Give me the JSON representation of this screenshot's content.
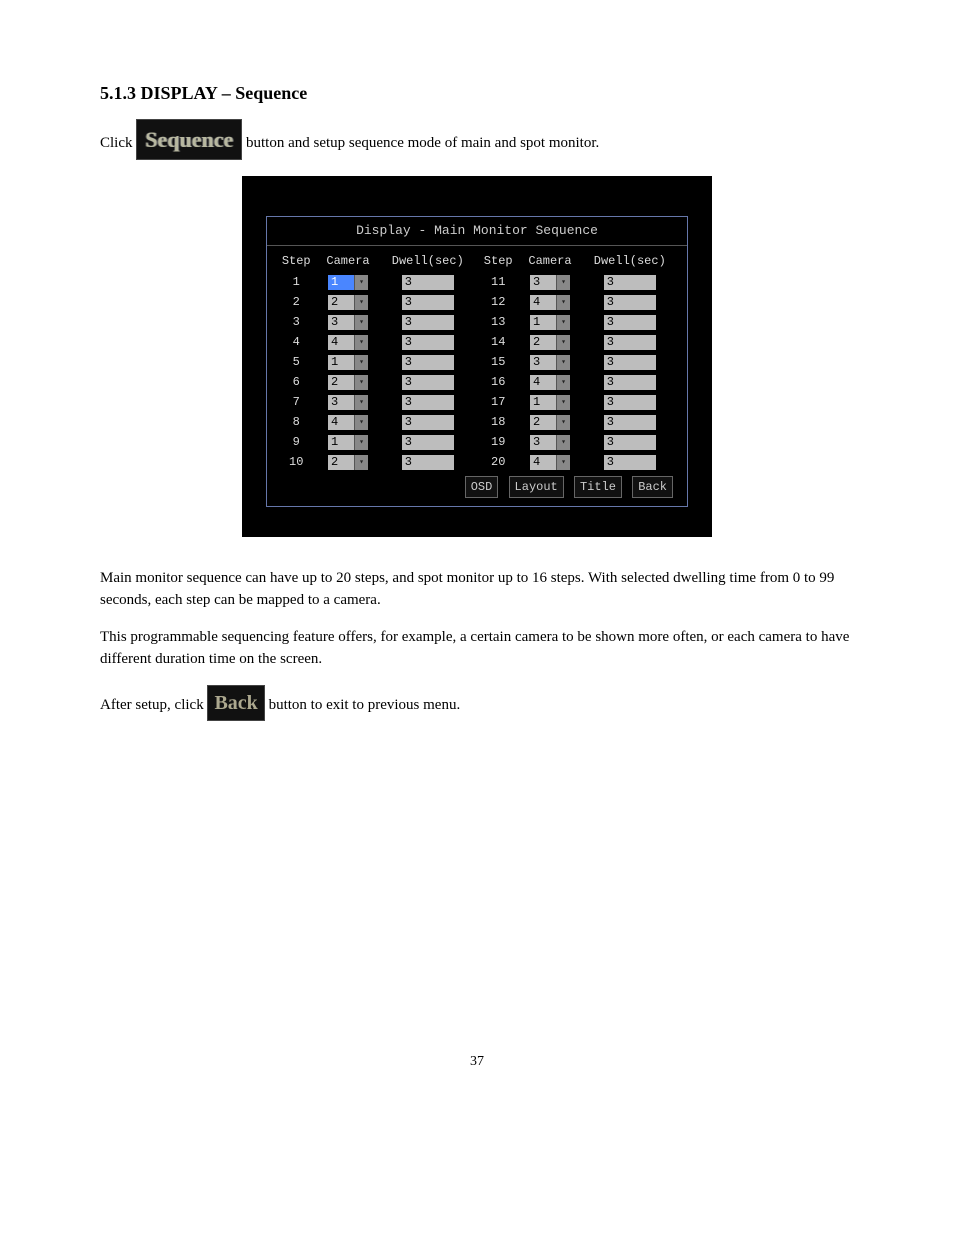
{
  "section1": {
    "title": "5.1.3 DISPLAY – Sequence",
    "click_prefix": "Click ",
    "button_label": "Sequence",
    "click_suffix": " button and setup sequence mode of main and spot monitor."
  },
  "screenshot": {
    "panel_title": "Display - Main Monitor Sequence",
    "headers": {
      "step": "Step",
      "camera": "Camera",
      "dwell": "Dwell(sec)"
    },
    "rows_left": [
      {
        "step": "1",
        "camera": "1",
        "dwell": "3",
        "selected": true
      },
      {
        "step": "2",
        "camera": "2",
        "dwell": "3"
      },
      {
        "step": "3",
        "camera": "3",
        "dwell": "3"
      },
      {
        "step": "4",
        "camera": "4",
        "dwell": "3"
      },
      {
        "step": "5",
        "camera": "1",
        "dwell": "3"
      },
      {
        "step": "6",
        "camera": "2",
        "dwell": "3"
      },
      {
        "step": "7",
        "camera": "3",
        "dwell": "3"
      },
      {
        "step": "8",
        "camera": "4",
        "dwell": "3"
      },
      {
        "step": "9",
        "camera": "1",
        "dwell": "3"
      },
      {
        "step": "10",
        "camera": "2",
        "dwell": "3"
      }
    ],
    "rows_right": [
      {
        "step": "11",
        "camera": "3",
        "dwell": "3"
      },
      {
        "step": "12",
        "camera": "4",
        "dwell": "3"
      },
      {
        "step": "13",
        "camera": "1",
        "dwell": "3"
      },
      {
        "step": "14",
        "camera": "2",
        "dwell": "3"
      },
      {
        "step": "15",
        "camera": "3",
        "dwell": "3"
      },
      {
        "step": "16",
        "camera": "4",
        "dwell": "3"
      },
      {
        "step": "17",
        "camera": "1",
        "dwell": "3"
      },
      {
        "step": "18",
        "camera": "2",
        "dwell": "3"
      },
      {
        "step": "19",
        "camera": "3",
        "dwell": "3"
      },
      {
        "step": "20",
        "camera": "4",
        "dwell": "3"
      }
    ],
    "buttons": {
      "osd": "OSD",
      "layout": "Layout",
      "title": "Title",
      "back": "Back"
    }
  },
  "desc": {
    "p1": "Main monitor sequence can have up to 20 steps, and spot monitor up to 16 steps. With selected dwelling time from 0 to 99 seconds, each step can be mapped to a camera.",
    "p2": "This programmable sequencing feature offers, for example, a certain camera to be shown more often, or each camera to have different duration time on the screen.",
    "p3_prefix": "After setup, click ",
    "back_label": "Back",
    "p3_suffix": " button to exit to previous menu."
  },
  "page_number": "37"
}
